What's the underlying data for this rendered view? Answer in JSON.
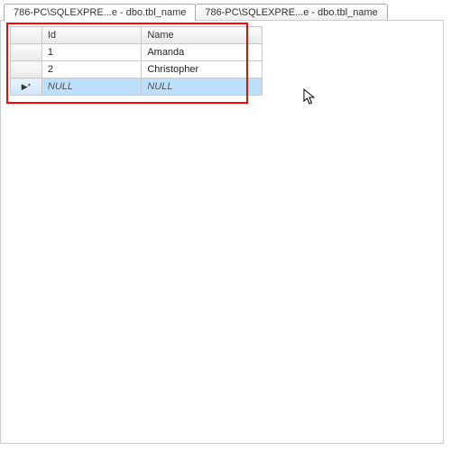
{
  "tabs": [
    {
      "label": "786-PC\\SQLEXPRE...e - dbo.tbl_name",
      "active": true
    },
    {
      "label": "786-PC\\SQLEXPRE...e - dbo.tbl_name",
      "active": false
    }
  ],
  "grid": {
    "columns": [
      "Id",
      "Name"
    ],
    "rows": [
      {
        "id": "1",
        "name": "Amanda"
      },
      {
        "id": "2",
        "name": "Christopher"
      }
    ],
    "null_text": "NULL"
  },
  "colors": {
    "highlight_border": "#ff0000",
    "selected_row_bg": "#bedffb"
  }
}
